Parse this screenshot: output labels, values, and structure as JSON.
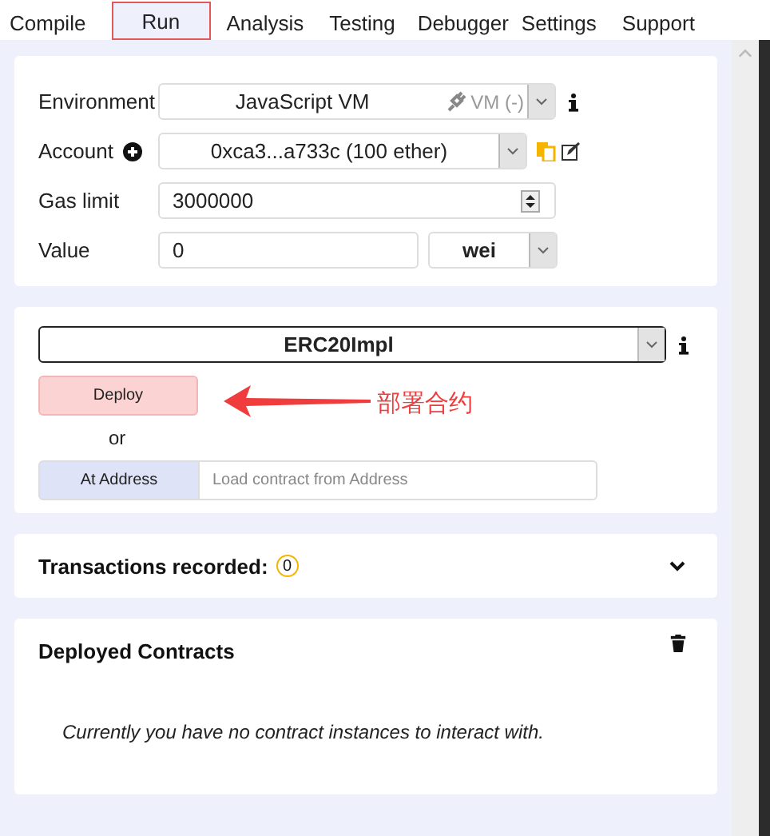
{
  "tabs": [
    {
      "label": "Compile",
      "selected": false
    },
    {
      "label": "Run",
      "selected": true
    },
    {
      "label": "Analysis",
      "selected": false
    },
    {
      "label": "Testing",
      "selected": false
    },
    {
      "label": "Debugger",
      "selected": false
    },
    {
      "label": "Settings",
      "selected": false
    },
    {
      "label": "Support",
      "selected": false
    }
  ],
  "settings": {
    "environment": {
      "label": "Environment",
      "value": "JavaScript VM",
      "status": "VM (-)"
    },
    "account": {
      "label": "Account",
      "value": "0xca3...a733c (100 ether)"
    },
    "gas_limit": {
      "label": "Gas limit",
      "value": "3000000"
    },
    "value": {
      "label": "Value",
      "value": "0",
      "unit": "wei"
    }
  },
  "contract": {
    "selected": "ERC20Impl",
    "deploy_button": "Deploy",
    "or": "or",
    "at_address_button": "At Address",
    "address_placeholder": "Load contract from Address"
  },
  "annotation": "部署合约",
  "transactions": {
    "title": "Transactions recorded:",
    "count": "0"
  },
  "deployed": {
    "title": "Deployed Contracts",
    "empty_message": "Currently you have no contract instances to interact with."
  }
}
